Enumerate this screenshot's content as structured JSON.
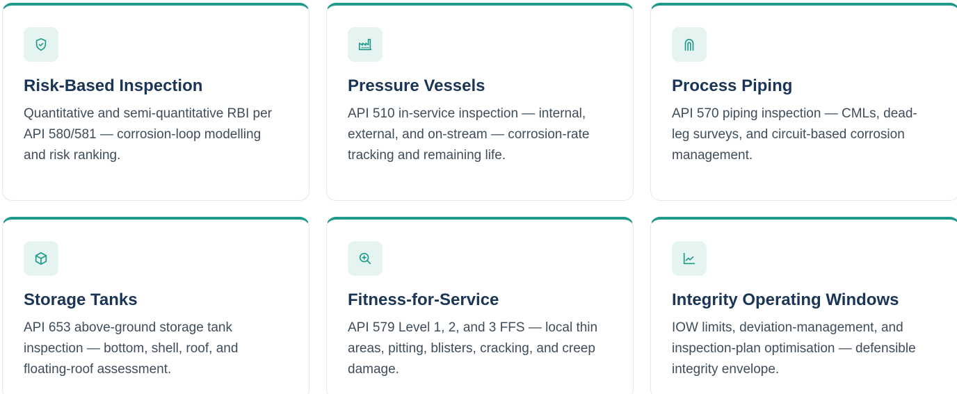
{
  "colors": {
    "accent": "#1f9a8a",
    "icon_bg": "#e6f4f1",
    "title": "#1b3556",
    "text": "#3f4c5a"
  },
  "cards": [
    {
      "icon": "shield-check-icon",
      "title": "Risk-Based Inspection",
      "description": "Quantitative and semi-quantitative RBI per API 580/581 — corrosion-loop modelling and risk ranking."
    },
    {
      "icon": "factory-icon",
      "title": "Pressure Vessels",
      "description": "API 510 in-service inspection — internal, external, and on-stream — corrosion-rate tracking and remaining life."
    },
    {
      "icon": "pipe-icon",
      "title": "Process Piping",
      "description": "API 570 piping inspection — CMLs, dead-leg surveys, and circuit-based corrosion management."
    },
    {
      "icon": "cube-icon",
      "title": "Storage Tanks",
      "description": "API 653 above-ground storage tank inspection — bottom, shell, roof, and floating-roof assessment."
    },
    {
      "icon": "zoom-in-icon",
      "title": "Fitness-for-Service",
      "description": "API 579 Level 1, 2, and 3 FFS — local thin areas, pitting, blisters, cracking, and creep damage."
    },
    {
      "icon": "line-chart-icon",
      "title": "Integrity Operating Windows",
      "description": "IOW limits, deviation-management, and inspection-plan optimisation — defensible integrity envelope."
    }
  ]
}
